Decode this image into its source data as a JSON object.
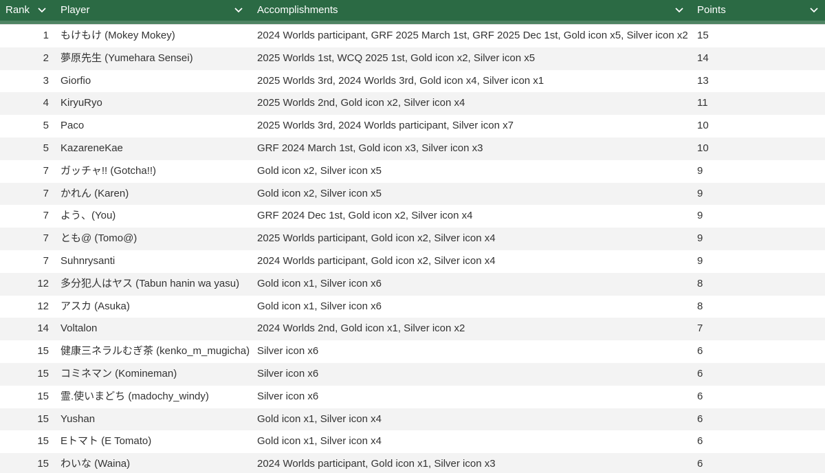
{
  "header": {
    "rank": "Rank",
    "player": "Player",
    "accomplishments": "Accomplishments",
    "points": "Points"
  },
  "colors": {
    "header_bg": "#2b6a44",
    "header_text": "#ffffff",
    "row_alt": "#f3f3f3",
    "text": "#333333"
  },
  "rows": [
    {
      "rank": "1",
      "player": "もけもけ (Mokey Mokey)",
      "accomplishments": "2024 Worlds participant, GRF 2025 March 1st, GRF 2025 Dec 1st, Gold icon x5, Silver icon x2",
      "points": "15"
    },
    {
      "rank": "2",
      "player": "夢原先生 (Yumehara Sensei)",
      "accomplishments": "2025 Worlds 1st, WCQ 2025 1st, Gold icon x2, Silver icon x5",
      "points": "14"
    },
    {
      "rank": "3",
      "player": "Giorfio",
      "accomplishments": "2025 Worlds 3rd, 2024 Worlds 3rd, Gold icon x4, Silver icon x1",
      "points": "13"
    },
    {
      "rank": "4",
      "player": "KiryuRyo",
      "accomplishments": "2025 Worlds 2nd, Gold icon x2, Silver icon x4",
      "points": "11"
    },
    {
      "rank": "5",
      "player": "Paco",
      "accomplishments": "2025 Worlds 3rd, 2024 Worlds participant, Silver icon x7",
      "points": "10"
    },
    {
      "rank": "5",
      "player": "KazareneKae",
      "accomplishments": "GRF 2024 March 1st, Gold icon x3, Silver icon x3",
      "points": "10"
    },
    {
      "rank": "7",
      "player": "ガッチャ!! (Gotcha!!)",
      "accomplishments": "Gold icon x2, Silver icon x5",
      "points": "9"
    },
    {
      "rank": "7",
      "player": "かれん (Karen)",
      "accomplishments": "Gold icon x2, Silver icon x5",
      "points": "9"
    },
    {
      "rank": "7",
      "player": "よう、(You)",
      "accomplishments": "GRF 2024 Dec 1st, Gold icon x2, Silver icon x4",
      "points": "9"
    },
    {
      "rank": "7",
      "player": "とも@ (Tomo@)",
      "accomplishments": "2025 Worlds participant, Gold icon x2, Silver icon x4",
      "points": "9"
    },
    {
      "rank": "7",
      "player": "Suhnrysanti",
      "accomplishments": "2024 Worlds participant, Gold icon x2, Silver icon x4",
      "points": "9"
    },
    {
      "rank": "12",
      "player": "多分犯人はヤス (Tabun hanin wa yasu)",
      "accomplishments": "Gold icon x1, Silver icon x6",
      "points": "8"
    },
    {
      "rank": "12",
      "player": "アスカ (Asuka)",
      "accomplishments": "Gold icon x1, Silver icon x6",
      "points": "8"
    },
    {
      "rank": "14",
      "player": "Voltalon",
      "accomplishments": "2024 Worlds 2nd, Gold icon x1, Silver icon x2",
      "points": "7"
    },
    {
      "rank": "15",
      "player": "健康三ネラルむぎ茶 (kenko_m_mugicha)",
      "accomplishments": "Silver icon x6",
      "points": "6"
    },
    {
      "rank": "15",
      "player": "コミネマン (Komineman)",
      "accomplishments": "Silver icon x6",
      "points": "6"
    },
    {
      "rank": "15",
      "player": "霊.使いまどち (madochy_windy)",
      "accomplishments": "Silver icon x6",
      "points": "6"
    },
    {
      "rank": "15",
      "player": "Yushan",
      "accomplishments": "Gold icon x1, Silver icon x4",
      "points": "6"
    },
    {
      "rank": "15",
      "player": "Eトマト (E Tomato)",
      "accomplishments": "Gold icon x1, Silver icon x4",
      "points": "6"
    },
    {
      "rank": "15",
      "player": "わいな (Waina)",
      "accomplishments": "2024 Worlds participant, Gold icon x1, Silver icon x3",
      "points": "6"
    }
  ]
}
